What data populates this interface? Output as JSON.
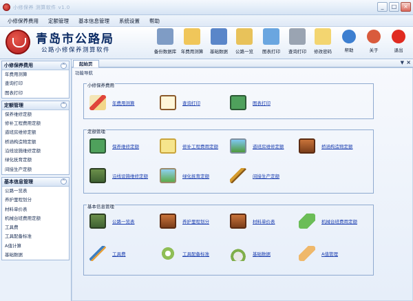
{
  "window": {
    "title": "小修保养 测算软件 v1.0",
    "buttons": [
      "_",
      "□",
      "×"
    ]
  },
  "menu": [
    "小修保养费用",
    "定额管理",
    "基本信息管理",
    "系统设置",
    "帮助"
  ],
  "brand": {
    "title": "青岛市公路局",
    "subtitle": "公路小修保养测算软件"
  },
  "toolbar": [
    {
      "label": "备份数据库",
      "icon": "database-backup-icon",
      "color": "#7f9cc5"
    },
    {
      "label": "年费用测算",
      "icon": "calculator-icon",
      "color": "#f0c65a"
    },
    {
      "label": "基础数据",
      "icon": "grid-data-icon",
      "color": "#5a86c9"
    },
    {
      "label": "公路一览",
      "icon": "calendar-table-icon",
      "color": "#e8c25a"
    },
    {
      "label": "图表打印",
      "icon": "bar-chart-icon",
      "color": "#6aa6e0"
    },
    {
      "label": "查询打印",
      "icon": "printer-icon",
      "color": "#9aa4b2"
    },
    {
      "label": "修改密码",
      "icon": "notepad-pen-icon",
      "color": "#f3d570"
    },
    {
      "label": "帮助",
      "icon": "help-icon",
      "color": "#3d7fd0"
    },
    {
      "label": "关于",
      "icon": "users-icon",
      "color": "#d95b3c"
    },
    {
      "label": "退出",
      "icon": "exit-icon",
      "color": "#e02b20"
    }
  ],
  "sidebar": [
    {
      "title": "小修保养费用",
      "items": [
        "年费用测算",
        "查询打印",
        "图表打印"
      ]
    },
    {
      "title": "定额管理",
      "items": [
        "保养维修定额",
        "修补工程费用定额",
        "道班房维修定额",
        "桥涵构造物定额",
        "沿线设施维修定额",
        "绿化抚育定额",
        "间接生产定额"
      ]
    },
    {
      "title": "基本信息管理",
      "items": [
        "公路一览表",
        "养护里程划分",
        "材料单价表",
        "机械台班费用定额",
        "工具费",
        "工具配备标准",
        "A值计算",
        "基础数据"
      ]
    }
  ],
  "tab": {
    "label": "起始页",
    "arrow": "▼",
    "close": "×"
  },
  "nav_title": "功能导航",
  "sections": [
    {
      "title": "小修保养费用",
      "entries": [
        {
          "label": "年费用测算",
          "icon": "pencil-ruler-icon"
        },
        {
          "label": "查询打印",
          "icon": "clipboard-icon"
        },
        {
          "label": "图表打印",
          "icon": "monitor-chart-icon"
        }
      ]
    },
    {
      "title": "定额管理",
      "entries": [
        {
          "label": "保养维修定额",
          "icon": "screen-icon"
        },
        {
          "label": "修补工程费用定额",
          "icon": "sticky-note-icon"
        },
        {
          "label": "道班房维修定额",
          "icon": "landscape-photo-icon"
        },
        {
          "label": "桥涵构造物定额",
          "icon": "drawer-icon"
        },
        {
          "label": "沿线设施维修定额",
          "icon": "book-icon"
        },
        {
          "label": "绿化抚育定额",
          "icon": "green-landscape-icon"
        },
        {
          "label": "间接生产定额",
          "icon": "broom-icon"
        }
      ]
    },
    {
      "title": "基本信息管理",
      "entries": [
        {
          "label": "公路一览表",
          "icon": "green-book-icon"
        },
        {
          "label": "养护里程划分",
          "icon": "brown-drawer-icon"
        },
        {
          "label": "材料单价表",
          "icon": "stacked-books-icon"
        },
        {
          "label": "机械台班费用定额",
          "icon": "diamond-gear-icon"
        },
        {
          "label": "工具费",
          "icon": "paintbrush-icon"
        },
        {
          "label": "工具配备标准",
          "icon": "gears-icon"
        },
        {
          "label": "基础数据",
          "icon": "envelope-bell-icon"
        },
        {
          "label": "A值管理",
          "icon": "ruler-icon"
        }
      ]
    }
  ]
}
